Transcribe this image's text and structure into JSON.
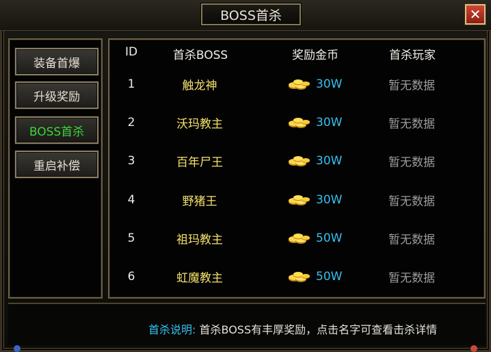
{
  "window": {
    "title": "BOSS首杀",
    "close_label": "✕"
  },
  "sidebar": {
    "items": [
      {
        "label": "装备首爆",
        "active": false
      },
      {
        "label": "升级奖励",
        "active": false
      },
      {
        "label": "BOSS首杀",
        "active": true
      },
      {
        "label": "重启补偿",
        "active": false
      }
    ]
  },
  "table": {
    "headers": {
      "id": "ID",
      "boss": "首杀BOSS",
      "reward": "奖励金币",
      "player": "首杀玩家"
    },
    "rows": [
      {
        "id": "1",
        "boss": "触龙神",
        "reward": "30W",
        "player": "暂无数据"
      },
      {
        "id": "2",
        "boss": "沃玛教主",
        "reward": "30W",
        "player": "暂无数据"
      },
      {
        "id": "3",
        "boss": "百年尸王",
        "reward": "30W",
        "player": "暂无数据"
      },
      {
        "id": "4",
        "boss": "野猪王",
        "reward": "30W",
        "player": "暂无数据"
      },
      {
        "id": "5",
        "boss": "祖玛教主",
        "reward": "50W",
        "player": "暂无数据"
      },
      {
        "id": "6",
        "boss": "虹魔教主",
        "reward": "50W",
        "player": "暂无数据"
      }
    ],
    "reward_icon": "gold-coins-icon"
  },
  "footer": {
    "note_label": "首杀说明:",
    "note_text": "首杀BOSS有丰厚奖励，点击名字可查看击杀详情"
  },
  "colors": {
    "boss_name": "#f3e06a",
    "reward": "#35c0ee",
    "active_tab": "#38d63a",
    "player": "#9b9b9b"
  }
}
